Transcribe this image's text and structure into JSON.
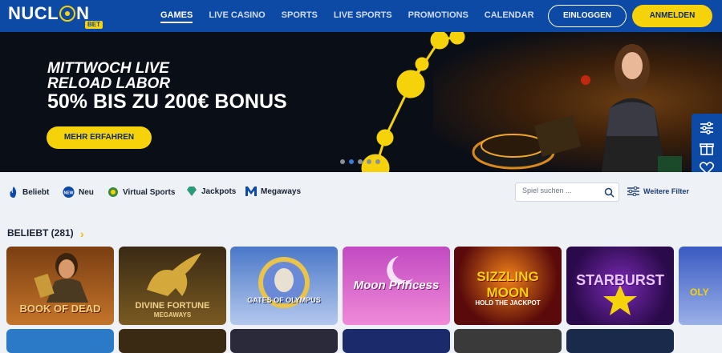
{
  "brand": {
    "name_left": "NUCL",
    "name_right": "N",
    "bet": "BET"
  },
  "nav": [
    {
      "label": "GAMES",
      "active": true
    },
    {
      "label": "LIVE CASINO",
      "active": false
    },
    {
      "label": "SPORTS",
      "active": false
    },
    {
      "label": "LIVE SPORTS",
      "active": false
    },
    {
      "label": "PROMOTIONS",
      "active": false
    },
    {
      "label": "CALENDAR",
      "active": false
    }
  ],
  "auth": {
    "login_label": "EINLOGGEN",
    "signup_label": "ANMELDEN"
  },
  "hero": {
    "line1": "MITTWOCH LIVE",
    "line2": "RELOAD LABOR",
    "line3": "50% BIS ZU 200€ BONUS",
    "cta_label": "MEHR ERFAHREN",
    "slides": 5,
    "active_slide": 2
  },
  "categories": [
    {
      "label": "Beliebt",
      "icon": "flame-icon"
    },
    {
      "label": "Neu",
      "icon": "new-badge-icon"
    },
    {
      "label": "Virtual Sports",
      "icon": "ball-icon"
    },
    {
      "label": "Jackpots",
      "icon": "diamond-icon"
    },
    {
      "label": "Megaways",
      "icon": "megaways-m-icon"
    }
  ],
  "search": {
    "placeholder": "Spiel suchen ..."
  },
  "filter": {
    "label": "Weitere Filter"
  },
  "section": {
    "title": "BELIEBT (281)"
  },
  "games": [
    {
      "title": "BOOK OF DEAD",
      "color_top": "#7a3e12",
      "color_bottom": "#c4742a"
    },
    {
      "title": "DIVINE FORTUNE",
      "sub": "MEGAWAYS",
      "color_top": "#3a2a14",
      "color_bottom": "#7a5a22"
    },
    {
      "title": "GATES OF OLYMPUS",
      "color_top": "#4a78c8",
      "color_bottom": "#b4c8ee"
    },
    {
      "title": "Moon Princess",
      "color_top": "#c24ac2",
      "color_bottom": "#f08ad8"
    },
    {
      "title": "SIZZLING MOON",
      "sub": "HOLD THE JACKPOT",
      "color_top": "#5a0a0a",
      "color_bottom": "#c2280e"
    },
    {
      "title": "STARBURST",
      "color_top": "#2a0a4a",
      "color_bottom": "#6a1a9a"
    },
    {
      "title": "OLY",
      "color_top": "#3a5ac2",
      "color_bottom": "#9ab0e8"
    }
  ]
}
